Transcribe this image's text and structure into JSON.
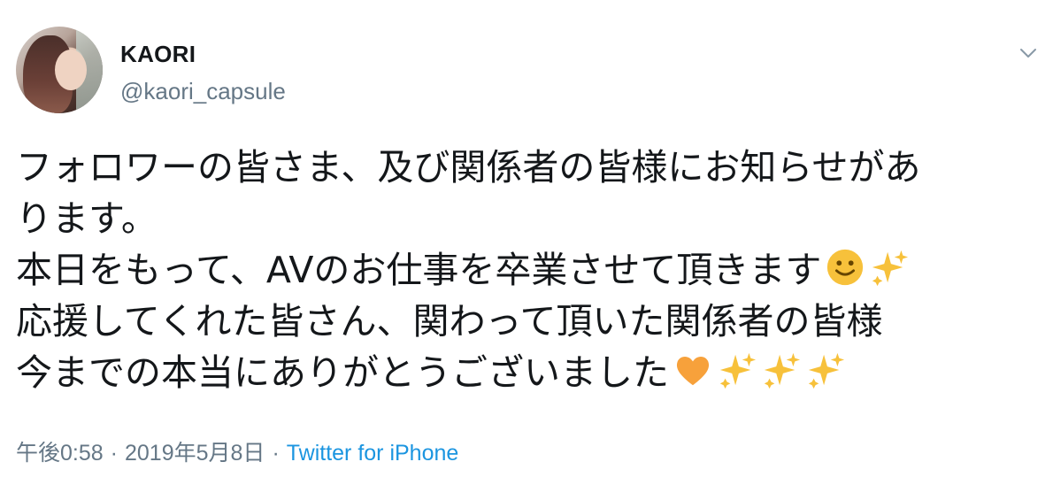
{
  "author": {
    "display_name": "KAORI",
    "handle": "@kaori_capsule"
  },
  "tweet": {
    "lines": [
      "フォロワーの皆さま、及び関係者の皆様にお知らせがあ",
      "ります。",
      "本日をもって、AVのお仕事を卒業させて頂きます",
      "応援してくれた皆さん、関わって頂いた関係者の皆様",
      "今までの本当にありがとうございました"
    ]
  },
  "meta": {
    "time": "午後0:58",
    "separator": "·",
    "date": "2019年5月8日",
    "source": "Twitter for iPhone"
  },
  "icons": {
    "caret": "chevron-down-icon",
    "smile": "slightly-smiling-face-emoji",
    "sparkles": "sparkles-emoji",
    "heart": "orange-heart-emoji"
  },
  "colors": {
    "text": "#14171a",
    "muted": "#657786",
    "link": "#1b95e0",
    "emoji_yellow": "#f7c13b",
    "heart_orange": "#f7a13b"
  }
}
